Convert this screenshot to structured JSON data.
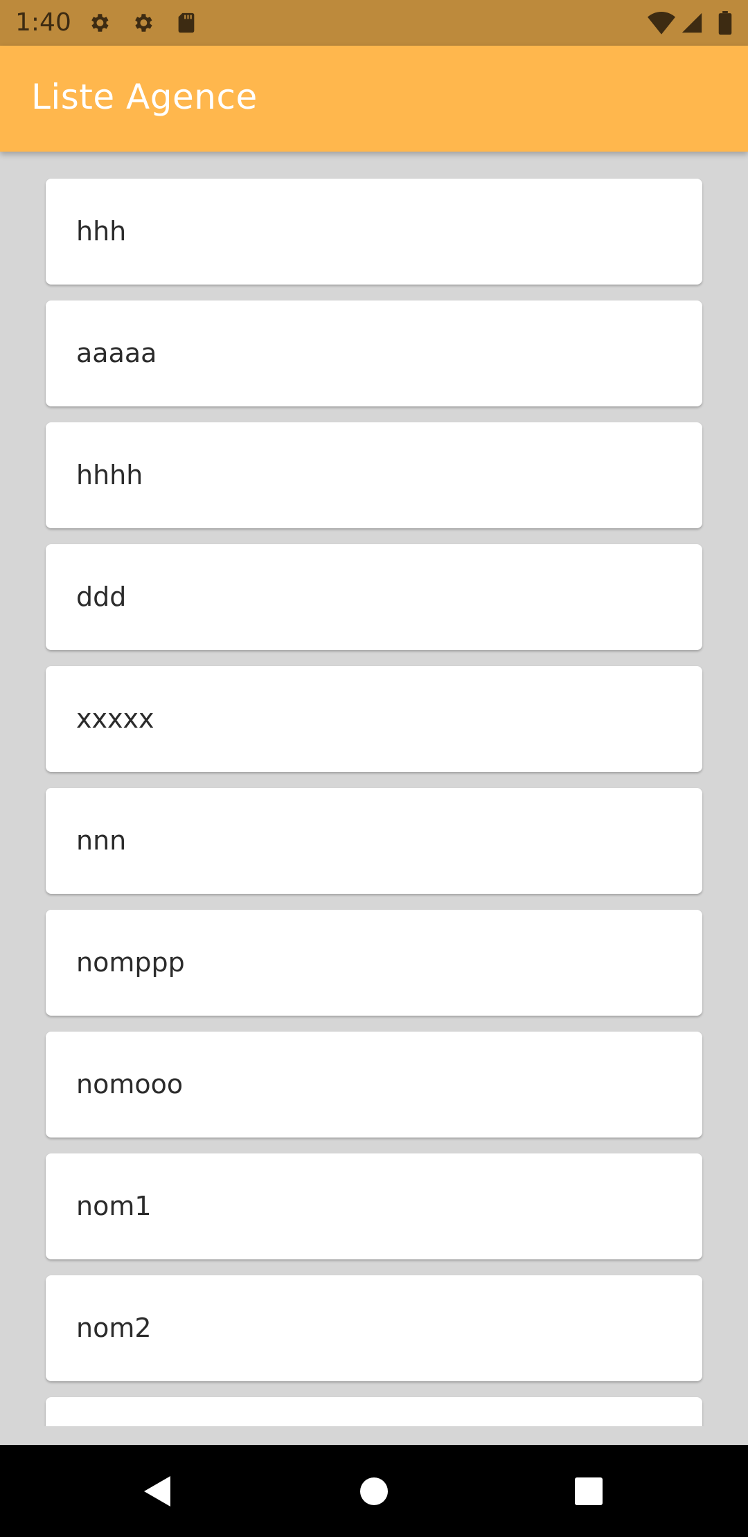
{
  "status_bar": {
    "time": "1:40",
    "icons_left": [
      "gear-icon",
      "gear-icon",
      "sd-card-icon"
    ],
    "icons_right": [
      "wifi-icon",
      "signal-icon",
      "battery-icon"
    ]
  },
  "app_bar": {
    "title": "Liste Agence",
    "color": "#ffb74d"
  },
  "list": {
    "items": [
      {
        "label": "hhh"
      },
      {
        "label": "aaaaa"
      },
      {
        "label": "hhhh"
      },
      {
        "label": "ddd"
      },
      {
        "label": "xxxxx"
      },
      {
        "label": "nnn"
      },
      {
        "label": "nomppp"
      },
      {
        "label": "nomooo"
      },
      {
        "label": "nom1"
      },
      {
        "label": "nom2"
      },
      {
        "label": ""
      }
    ]
  },
  "nav_bar": {
    "buttons": [
      "back-icon",
      "home-icon",
      "recents-icon"
    ]
  }
}
